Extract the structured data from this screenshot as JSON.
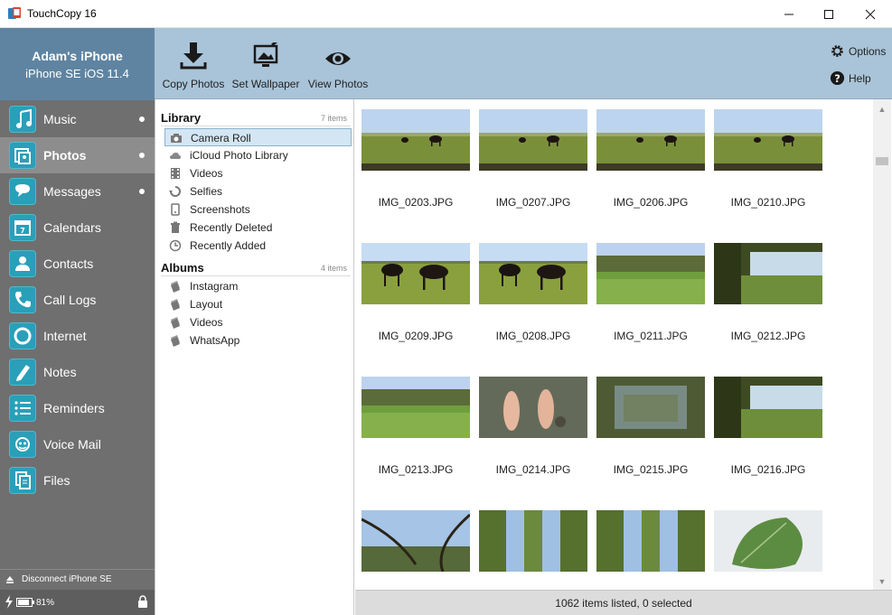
{
  "window": {
    "title": "TouchCopy 16"
  },
  "device": {
    "name": "Adam's iPhone",
    "model": "iPhone SE iOS 11.4"
  },
  "nav": [
    {
      "label": "Music",
      "icon": "music-icon",
      "dot": true
    },
    {
      "label": "Photos",
      "icon": "photos-icon",
      "dot": true,
      "active": true
    },
    {
      "label": "Messages",
      "icon": "messages-icon",
      "dot": true
    },
    {
      "label": "Calendars",
      "icon": "calendar-icon"
    },
    {
      "label": "Contacts",
      "icon": "contacts-icon"
    },
    {
      "label": "Call Logs",
      "icon": "phone-icon"
    },
    {
      "label": "Internet",
      "icon": "internet-icon"
    },
    {
      "label": "Notes",
      "icon": "notes-icon"
    },
    {
      "label": "Reminders",
      "icon": "reminders-icon"
    },
    {
      "label": "Voice Mail",
      "icon": "voicemail-icon"
    },
    {
      "label": "Files",
      "icon": "files-icon"
    }
  ],
  "sidebar_footer": {
    "disconnect": "Disconnect iPhone SE",
    "battery": "81%"
  },
  "toolbar": {
    "copy_photos": "Copy Photos",
    "set_wallpaper": "Set Wallpaper",
    "view_photos": "View Photos",
    "options": "Options",
    "help": "Help"
  },
  "library": {
    "title": "Library",
    "count": "7 items",
    "items": [
      "Camera Roll",
      "iCloud Photo Library",
      "Videos",
      "Selfies",
      "Screenshots",
      "Recently Deleted",
      "Recently Added"
    ],
    "selected": "Camera Roll"
  },
  "albums": {
    "title": "Albums",
    "count": "4 items",
    "items": [
      "Instagram",
      "Layout",
      "Videos",
      "WhatsApp"
    ]
  },
  "photos": [
    {
      "name": "IMG_0203.JPG",
      "scene": "horse-field"
    },
    {
      "name": "IMG_0207.JPG",
      "scene": "horse-field"
    },
    {
      "name": "IMG_0206.JPG",
      "scene": "horse-field"
    },
    {
      "name": "IMG_0210.JPG",
      "scene": "horse-field"
    },
    {
      "name": "IMG_0209.JPG",
      "scene": "horse-close"
    },
    {
      "name": "IMG_0208.JPG",
      "scene": "horse-close"
    },
    {
      "name": "IMG_0211.JPG",
      "scene": "field-trees"
    },
    {
      "name": "IMG_0212.JPG",
      "scene": "field-shade"
    },
    {
      "name": "IMG_0213.JPG",
      "scene": "field-trees"
    },
    {
      "name": "IMG_0214.JPG",
      "scene": "feet-water"
    },
    {
      "name": "IMG_0215.JPG",
      "scene": "water-reflect"
    },
    {
      "name": "IMG_0216.JPG",
      "scene": "field-shade"
    },
    {
      "name": "",
      "scene": "branches"
    },
    {
      "name": "",
      "scene": "rotated-trees"
    },
    {
      "name": "",
      "scene": "rotated-trees"
    },
    {
      "name": "",
      "scene": "leaf"
    }
  ],
  "status": {
    "text": "1062 items listed, 0 selected"
  }
}
